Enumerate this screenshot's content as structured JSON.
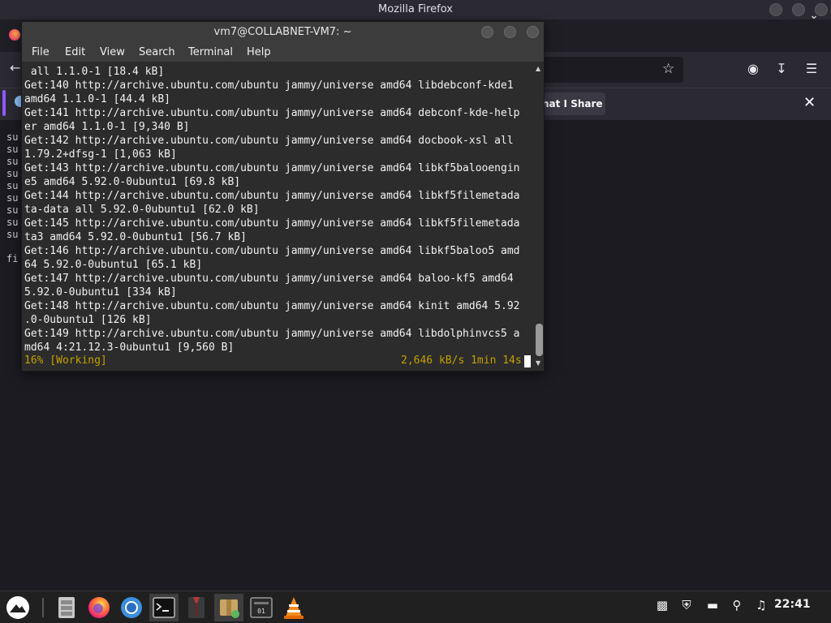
{
  "firefox": {
    "window_title": "Mozilla Firefox",
    "share_button_label": "hat I Share",
    "content_lines": [
      "su",
      "su",
      "su",
      "su",
      "su",
      "su",
      "su",
      "su",
      "su",
      "",
      "fi"
    ]
  },
  "terminal": {
    "title": "vm7@COLLABNET-VM7: ~",
    "menu": [
      "File",
      "Edit",
      "View",
      "Search",
      "Terminal",
      "Help"
    ],
    "lines": [
      " all 1.1.0-1 [18.4 kB]",
      "Get:140 http://archive.ubuntu.com/ubuntu jammy/universe amd64 libdebconf-kde1",
      "amd64 1.1.0-1 [44.4 kB]",
      "Get:141 http://archive.ubuntu.com/ubuntu jammy/universe amd64 debconf-kde-help",
      "er amd64 1.1.0-1 [9,340 B]",
      "Get:142 http://archive.ubuntu.com/ubuntu jammy/universe amd64 docbook-xsl all",
      "1.79.2+dfsg-1 [1,063 kB]",
      "Get:143 http://archive.ubuntu.com/ubuntu jammy/universe amd64 libkf5balooengin",
      "e5 amd64 5.92.0-0ubuntu1 [69.8 kB]",
      "Get:144 http://archive.ubuntu.com/ubuntu jammy/universe amd64 libkf5filemetada",
      "ta-data all 5.92.0-0ubuntu1 [62.0 kB]",
      "Get:145 http://archive.ubuntu.com/ubuntu jammy/universe amd64 libkf5filemetada",
      "ta3 amd64 5.92.0-0ubuntu1 [56.7 kB]",
      "Get:146 http://archive.ubuntu.com/ubuntu jammy/universe amd64 libkf5baloo5 amd",
      "64 5.92.0-0ubuntu1 [65.1 kB]",
      "Get:147 http://archive.ubuntu.com/ubuntu jammy/universe amd64 baloo-kf5 amd64",
      "5.92.0-0ubuntu1 [334 kB]",
      "Get:148 http://archive.ubuntu.com/ubuntu jammy/universe amd64 kinit amd64 5.92",
      ".0-0ubuntu1 [126 kB]",
      "Get:149 http://archive.ubuntu.com/ubuntu jammy/universe amd64 libdolphinvcs5 a",
      "md64 4:21.12.3-0ubuntu1 [9,560 B]"
    ],
    "status_left": "16% [Working]",
    "status_right": "2,646 kB/s 1min 14s",
    "status_color": "#c4a000"
  },
  "taskbar": {
    "clock": "22:41",
    "apps": [
      "start-menu-icon",
      "file-manager-icon",
      "firefox-icon",
      "chromium-icon",
      "terminal-icon",
      "gnome-tweaks-icon",
      "archive-manager-icon",
      "system-monitor-icon",
      "vlc-icon"
    ],
    "tray": [
      "clipboard-icon",
      "shield-icon",
      "keyboard-icon",
      "network-icon",
      "music-icon"
    ]
  }
}
